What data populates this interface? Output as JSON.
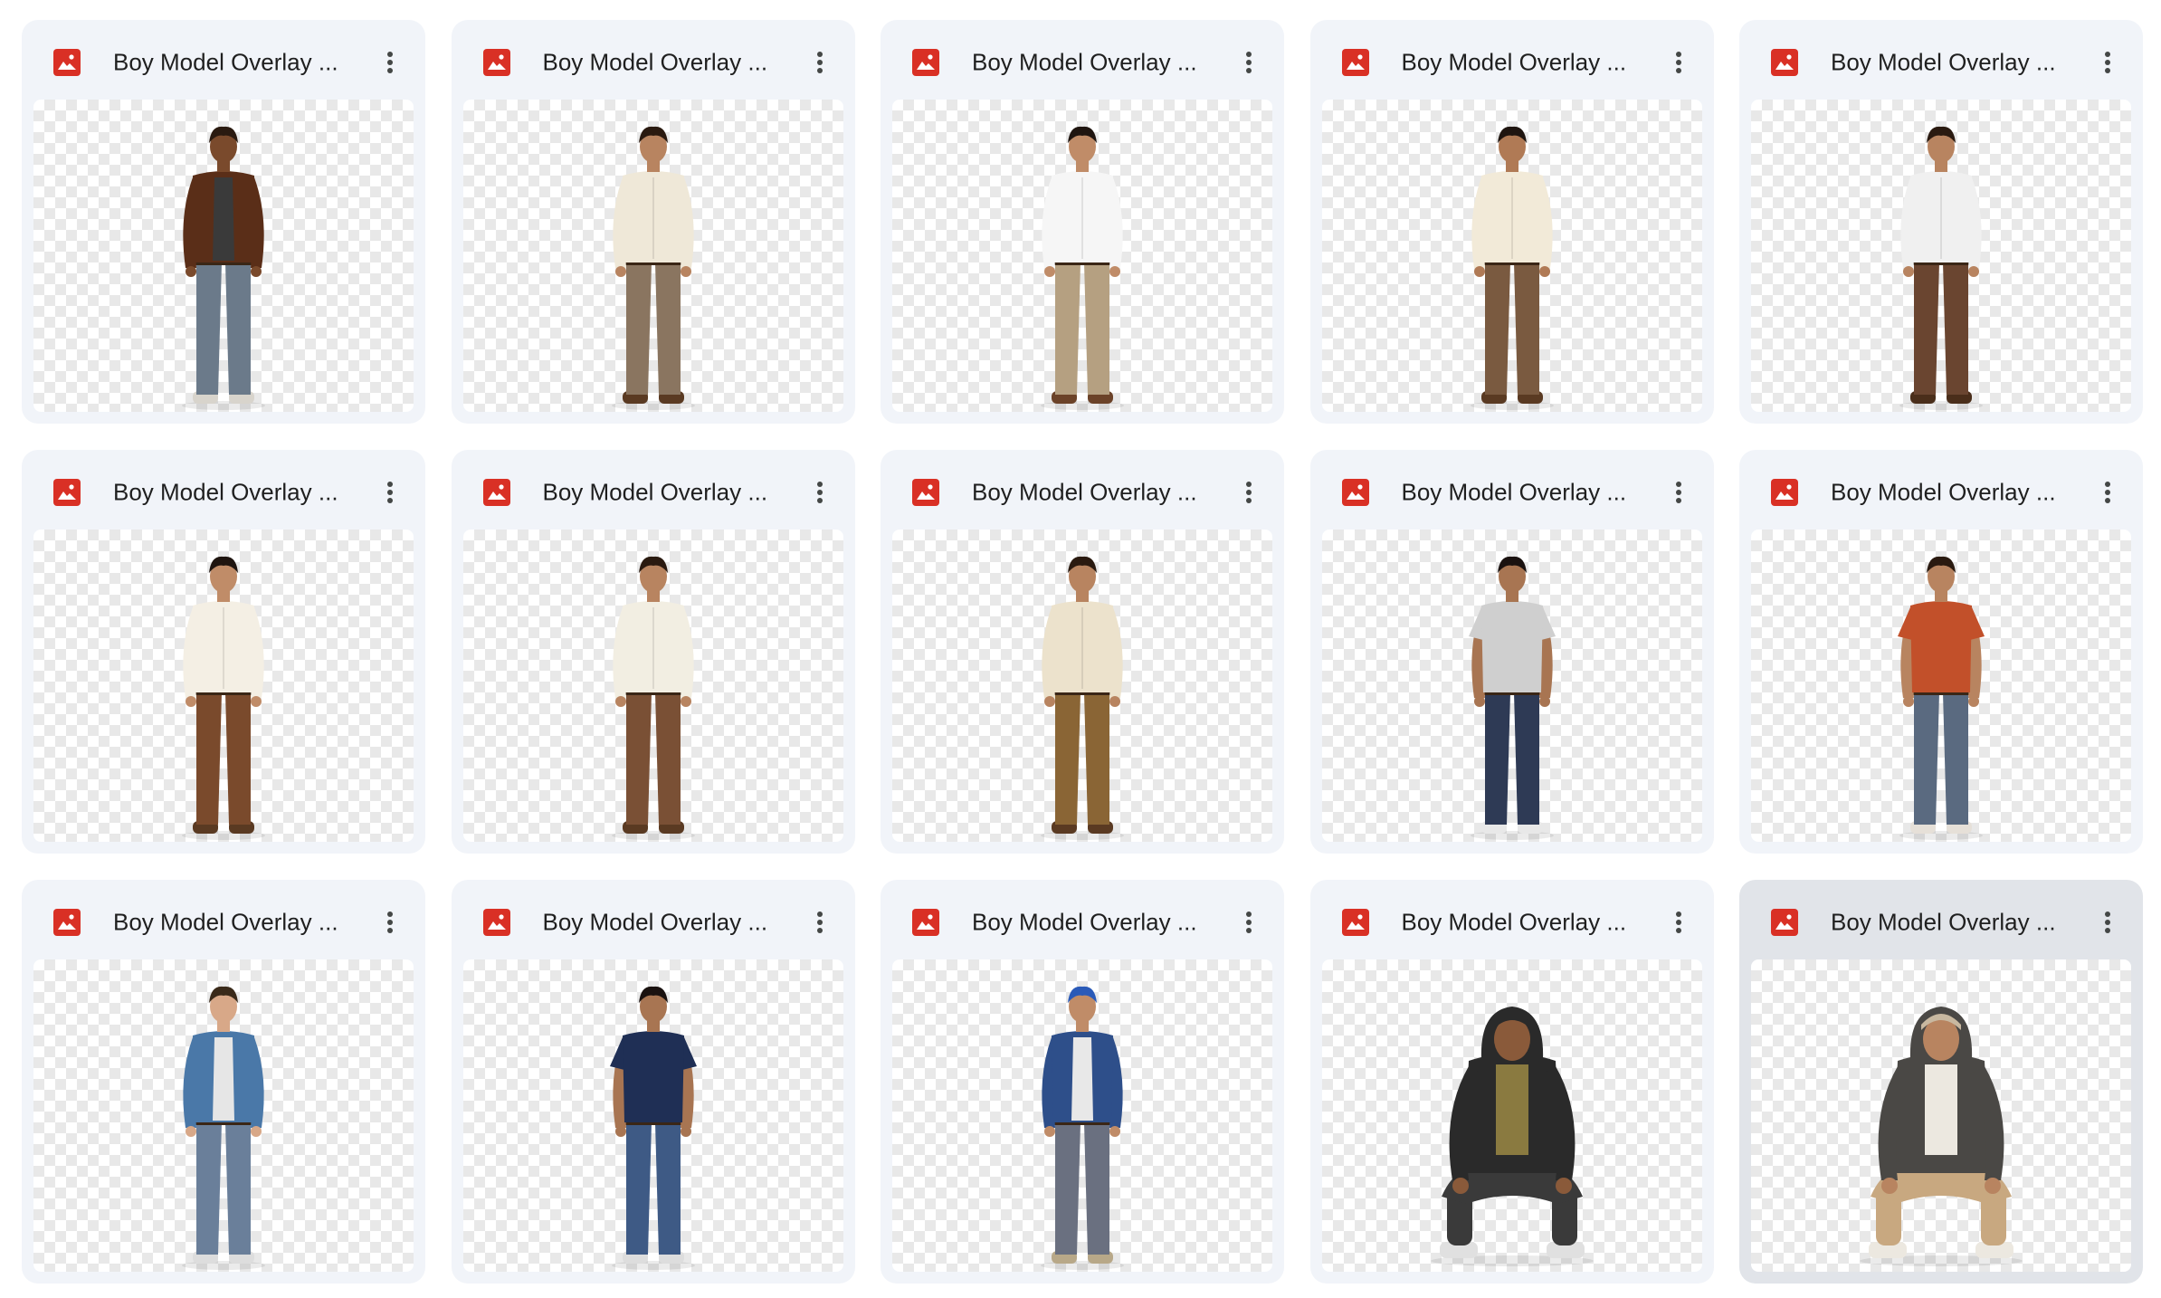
{
  "colors": {
    "card_bg": "#f1f4f9",
    "card_selected_bg": "#e1e4e9",
    "image_icon": "#d93025",
    "title_text": "#1f1f1f",
    "menu_dots": "#444746"
  },
  "files": [
    {
      "title": "Boy Model Overlay ...",
      "icon": "image-file-icon",
      "pose": "standing",
      "skin": "#7a4a2c",
      "hair": "#2a1a10",
      "top": "#5a2e18",
      "top_style": "jacket",
      "inner": "#3a3a3a",
      "pants": "#6b7a8a",
      "shoes": "#d8d4cc",
      "selected": false
    },
    {
      "title": "Boy Model Overlay ...",
      "icon": "image-file-icon",
      "pose": "standing",
      "skin": "#b88460",
      "hair": "#2a1a10",
      "top": "#efe8d8",
      "top_style": "shirt",
      "inner": "#efe8d8",
      "pants": "#8a7560",
      "shoes": "#5a3a22",
      "selected": false
    },
    {
      "title": "Boy Model Overlay ...",
      "icon": "image-file-icon",
      "pose": "standing",
      "skin": "#c08c68",
      "hair": "#1f1510",
      "top": "#f6f6f6",
      "top_style": "shirt",
      "inner": "#f6f6f6",
      "pants": "#b5a081",
      "shoes": "#6b4228",
      "selected": false
    },
    {
      "title": "Boy Model Overlay ...",
      "icon": "image-file-icon",
      "pose": "standing",
      "skin": "#b07a55",
      "hair": "#1f1510",
      "top": "#f2ead8",
      "top_style": "shirt",
      "inner": "#f2ead8",
      "pants": "#7a5a40",
      "shoes": "#5a3a22",
      "selected": false
    },
    {
      "title": "Boy Model Overlay ...",
      "icon": "image-file-icon",
      "pose": "standing",
      "skin": "#b88460",
      "hair": "#2a1a10",
      "top": "#f0f0f0",
      "top_style": "shirt",
      "inner": "#f0f0f0",
      "pants": "#6a4530",
      "shoes": "#4a2e1a",
      "selected": false
    },
    {
      "title": "Boy Model Overlay ...",
      "icon": "image-file-icon",
      "pose": "standing",
      "skin": "#c08c68",
      "hair": "#1f1510",
      "top": "#f4efe4",
      "top_style": "shirt",
      "inner": "#f4efe4",
      "pants": "#7a4a2c",
      "shoes": "#5a3a22",
      "selected": false
    },
    {
      "title": "Boy Model Overlay ...",
      "icon": "image-file-icon",
      "pose": "standing",
      "skin": "#b88460",
      "hair": "#2a1a10",
      "top": "#f2eee2",
      "top_style": "shirt",
      "inner": "#f2eee2",
      "pants": "#7a5035",
      "shoes": "#5a3a22",
      "selected": false
    },
    {
      "title": "Boy Model Overlay ...",
      "icon": "image-file-icon",
      "pose": "standing",
      "skin": "#b88460",
      "hair": "#2a1a10",
      "top": "#ece2cc",
      "top_style": "shirt",
      "inner": "#ece2cc",
      "pants": "#8a6535",
      "shoes": "#5a3a22",
      "selected": false
    },
    {
      "title": "Boy Model Overlay ...",
      "icon": "image-file-icon",
      "pose": "standing",
      "skin": "#a87552",
      "hair": "#1a1210",
      "top": "#cfcfcf",
      "top_style": "tee",
      "inner": "#cfcfcf",
      "pants": "#2e3a55",
      "shoes": "#e8e8e8",
      "selected": false
    },
    {
      "title": "Boy Model Overlay ...",
      "icon": "image-file-icon",
      "pose": "standing",
      "skin": "#b88460",
      "hair": "#2a1a10",
      "top": "#c2502a",
      "top_style": "tee",
      "inner": "#c2502a",
      "pants": "#5a6a80",
      "shoes": "#e6e0d8",
      "selected": false
    },
    {
      "title": "Boy Model Overlay ...",
      "icon": "image-file-icon",
      "pose": "standing",
      "skin": "#d8a888",
      "hair": "#3a2a1a",
      "top": "#4a78a8",
      "top_style": "jacket",
      "inner": "#e6e6e6",
      "pants": "#6a7f9a",
      "shoes": "#dddddd",
      "selected": false
    },
    {
      "title": "Boy Model Overlay ...",
      "icon": "image-file-icon",
      "pose": "standing",
      "skin": "#a87552",
      "hair": "#1a1210",
      "top": "#1f2f55",
      "top_style": "tee",
      "inner": "#f0f0f0",
      "pants": "#3e5a85",
      "shoes": "#dddddd",
      "selected": false
    },
    {
      "title": "Boy Model Overlay ...",
      "icon": "image-file-icon",
      "pose": "standing",
      "skin": "#c08c68",
      "hair": "#2a5ab8",
      "top": "#2e4f8a",
      "top_style": "jacket",
      "inner": "#e8e8e8",
      "pants": "#6a7080",
      "shoes": "#b8a888",
      "selected": false
    },
    {
      "title": "Boy Model Overlay ...",
      "icon": "image-file-icon",
      "pose": "squat",
      "skin": "#8a5a3a",
      "hair": "#2a2a2a",
      "top": "#2a2a2a",
      "top_style": "hoodie",
      "inner": "#8a7a40",
      "pants": "#3a3a3a",
      "shoes": "#e0e0e0",
      "selected": false
    },
    {
      "title": "Boy Model Overlay ...",
      "icon": "image-file-icon",
      "pose": "squat",
      "skin": "#b88460",
      "hair": "#c8b8a0",
      "top": "#4a4845",
      "top_style": "hoodie",
      "inner": "#ece8e0",
      "pants": "#c8a880",
      "shoes": "#ece8e0",
      "selected": true
    }
  ]
}
